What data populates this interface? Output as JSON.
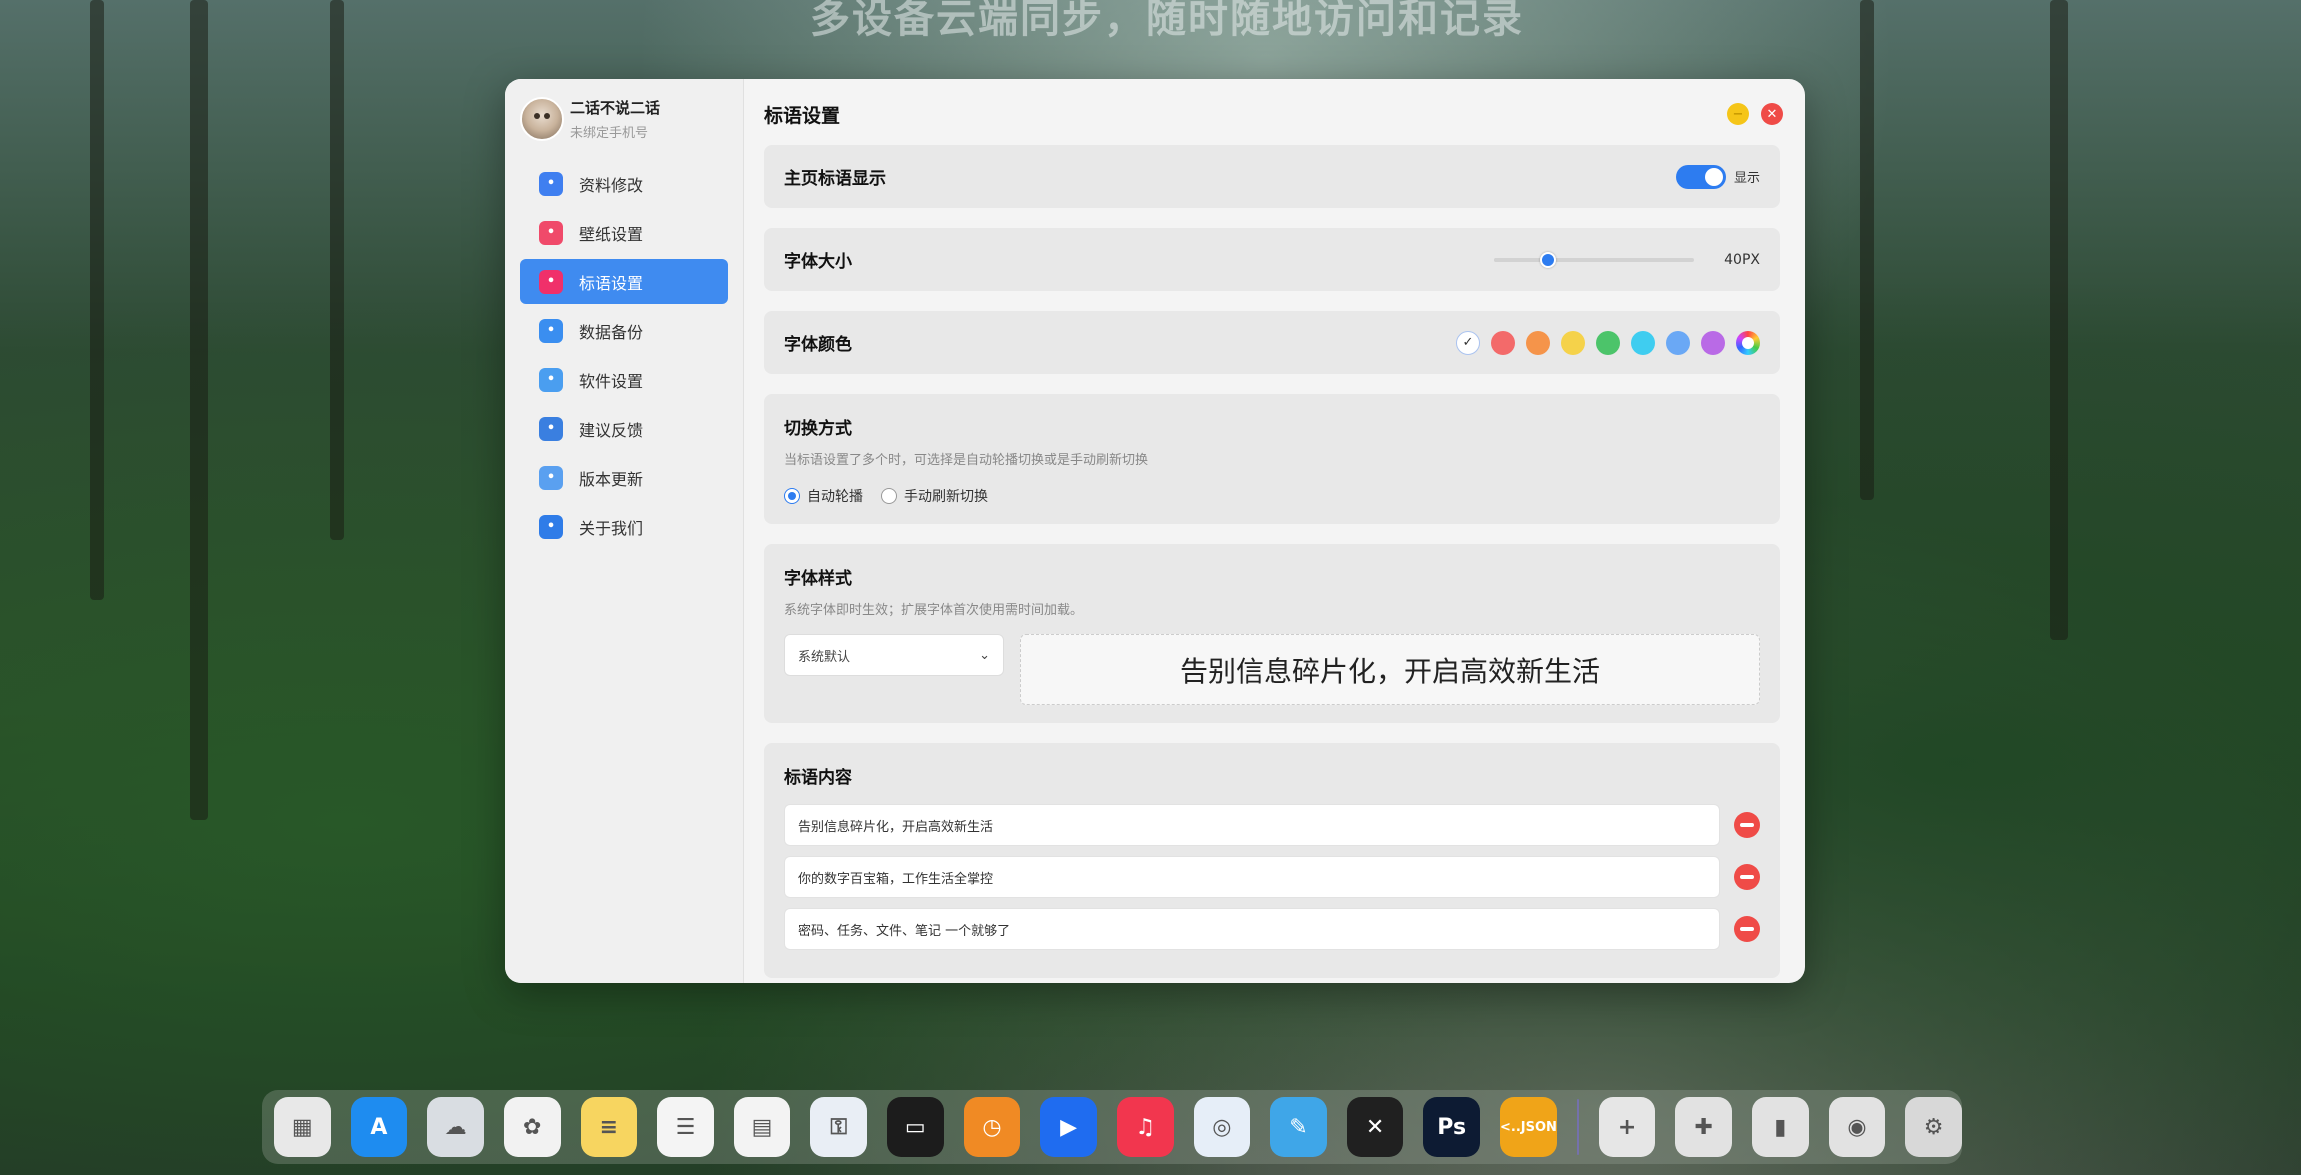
{
  "background_headline": "多设备云端同步，随时随地访问和记录",
  "profile": {
    "name": "二话不说二话",
    "subtitle": "未绑定手机号"
  },
  "sidebar": {
    "items": [
      {
        "label": "资料修改",
        "icon": "user-icon",
        "color": "#3f7ff0"
      },
      {
        "label": "壁纸设置",
        "icon": "wallpaper-icon",
        "color": "#f04a6a"
      },
      {
        "label": "标语设置",
        "icon": "quote-icon",
        "color": "#f0306a",
        "active": true
      },
      {
        "label": "数据备份",
        "icon": "cloud-icon",
        "color": "#3a8ef0"
      },
      {
        "label": "软件设置",
        "icon": "monitor-icon",
        "color": "#4a9ef0"
      },
      {
        "label": "建议反馈",
        "icon": "feedback-icon",
        "color": "#3a7fe0"
      },
      {
        "label": "版本更新",
        "icon": "update-icon",
        "color": "#5aa0f0"
      },
      {
        "label": "关于我们",
        "icon": "info-icon",
        "color": "#2f7ce8"
      }
    ]
  },
  "page_title": "标语设置",
  "home_display": {
    "title": "主页标语显示",
    "toggle_label": "显示",
    "enabled": true
  },
  "font_size": {
    "title": "字体大小",
    "value_label": "40PX",
    "fraction": 0.27
  },
  "font_color": {
    "title": "字体颜色",
    "swatches": [
      "#ffffff",
      "#f36a6a",
      "#f5944a",
      "#f5d24a",
      "#4cc46a",
      "#3fcdf0",
      "#6aa8f5",
      "#b96ae6",
      "rainbow"
    ],
    "selected_index": 0
  },
  "switch_mode": {
    "title": "切换方式",
    "description": "当标语设置了多个时，可选择是自动轮播切换或是手动刷新切换",
    "options": [
      "自动轮播",
      "手动刷新切换"
    ],
    "selected": 0
  },
  "font_style": {
    "title": "字体样式",
    "description": "系统字体即时生效；扩展字体首次使用需时间加载。",
    "select_value": "系统默认",
    "preview_text": "告别信息碎片化，开启高效新生活"
  },
  "slogans": {
    "title": "标语内容",
    "items": [
      "告别信息碎片化，开启高效新生活",
      "你的数字百宝箱，工作生活全掌控",
      "密码、任务、文件、笔记 一个就够了"
    ]
  },
  "dock": [
    {
      "name": "launchpad-icon",
      "color": "#e8e8e8",
      "glyph": "▦"
    },
    {
      "name": "app-store-icon",
      "color": "#1e8cf0",
      "glyph": "A"
    },
    {
      "name": "icloud-icon",
      "color": "#d9dde2",
      "glyph": "☁"
    },
    {
      "name": "photos-icon",
      "color": "#f2f2f2",
      "glyph": "✿"
    },
    {
      "name": "notes-icon",
      "color": "#f7d560",
      "glyph": "≡"
    },
    {
      "name": "reminders-icon",
      "color": "#f4f4f4",
      "glyph": "☰"
    },
    {
      "name": "calendar-icon",
      "color": "#f3f3f3",
      "glyph": "▤"
    },
    {
      "name": "passwords-icon",
      "color": "#e9eef5",
      "glyph": "⚿"
    },
    {
      "name": "wallet-icon",
      "color": "#1c1c1c",
      "glyph": "▭"
    },
    {
      "name": "clock-icon",
      "color": "#f08a24",
      "glyph": "◷"
    },
    {
      "name": "play-icon",
      "color": "#1f6cf0",
      "glyph": "▶"
    },
    {
      "name": "music-icon",
      "color": "#f2364e",
      "glyph": "♫"
    },
    {
      "name": "safari-icon",
      "color": "#e6eef8",
      "glyph": "◎"
    },
    {
      "name": "pencil-icon",
      "color": "#3fa6e8",
      "glyph": "✎"
    },
    {
      "name": "blender-icon",
      "color": "#202020",
      "glyph": "✕"
    },
    {
      "name": "photoshop-icon",
      "color": "#0d1b33",
      "glyph": "Ps"
    },
    {
      "name": "json-icon",
      "color": "#f0a418",
      "glyph": "{}"
    },
    {
      "name": "add-icon",
      "color": "#e6e6e6",
      "glyph": "+"
    },
    {
      "name": "plugin-icon",
      "color": "#e2e2e2",
      "glyph": "✚"
    },
    {
      "name": "brush-icon",
      "color": "#e2e2e2",
      "glyph": "▮"
    },
    {
      "name": "speaker-icon",
      "color": "#e2e2e2",
      "glyph": "◉"
    },
    {
      "name": "settings-icon",
      "color": "#d8d8d8",
      "glyph": "⚙"
    }
  ],
  "dock_json_label": "<..JSON"
}
